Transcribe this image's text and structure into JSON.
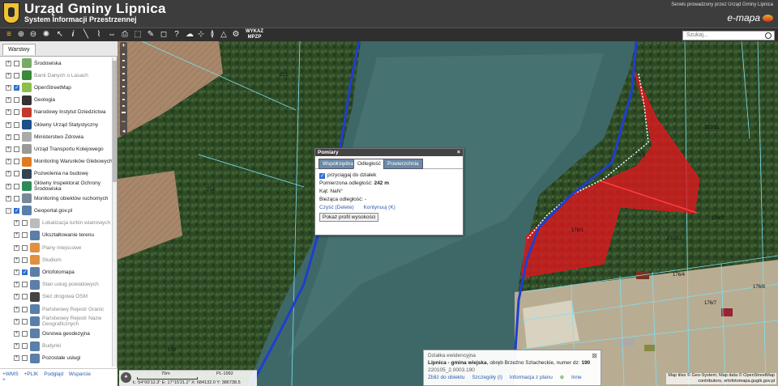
{
  "header": {
    "title": "Urząd Gminy Lipnica",
    "subtitle": "System Informacji Przestrzennej",
    "provider": "Serwis prowadzony przez Urząd Gminy Lipnica",
    "logo_text": "e-mapa"
  },
  "toolbar": {
    "wykaz_line1": "WYKAZ",
    "wykaz_line2": "MPZP",
    "search_placeholder": "Szukaj..."
  },
  "panel": {
    "tab_label": "Warstwy",
    "layers": [
      {
        "label": "Środowiska",
        "checked": false,
        "dim": false,
        "icon": "layer-icon",
        "color": "#7a6"
      },
      {
        "label": "Bank Danych o Lasach",
        "checked": false,
        "dim": true,
        "icon": "forest-icon",
        "color": "#3a8a3a"
      },
      {
        "label": "OpenStreetMap",
        "checked": true,
        "dim": false,
        "icon": "osm-icon",
        "color": "#8bbf4a"
      },
      {
        "label": "Geologia",
        "checked": false,
        "dim": false,
        "icon": "hammer-icon",
        "color": "#333"
      },
      {
        "label": "Narodowy Instytut Dziedzictwa",
        "checked": false,
        "dim": false,
        "icon": "heritage-icon",
        "color": "#c0392b"
      },
      {
        "label": "Główny Urząd Statystyczny",
        "checked": false,
        "dim": false,
        "icon": "stats-icon",
        "color": "#1a4f8a"
      },
      {
        "label": "Ministerstwo Zdrowia",
        "checked": false,
        "dim": false,
        "icon": "health-icon",
        "color": "#aaa"
      },
      {
        "label": "Urząd Transportu Kolejowego",
        "checked": false,
        "dim": false,
        "icon": "rail-icon",
        "color": "#999"
      },
      {
        "label": "Monitoring Warunków Glebowych",
        "checked": false,
        "dim": false,
        "icon": "soil-icon",
        "color": "#e07b20"
      },
      {
        "label": "Pozwolenia na budowę",
        "checked": false,
        "dim": false,
        "icon": "permit-icon",
        "color": "#345"
      },
      {
        "label": "Główny Inspektorat Ochrony Środowiska",
        "checked": false,
        "dim": false,
        "icon": "gios-icon",
        "color": "#2e8b57"
      },
      {
        "label": "Monitoring obiektów ruchomych",
        "checked": false,
        "dim": false,
        "icon": "tracking-icon",
        "color": "#789"
      },
      {
        "label": "Geoportal.gov.pl",
        "checked": true,
        "dim": false,
        "icon": "geoportal-icon",
        "color": "#5a7fa8",
        "expanded": true
      },
      {
        "label": "Lokalizacja turbin wiatrowych",
        "checked": false,
        "dim": true,
        "icon": "turbine-icon",
        "color": "#bbb",
        "child": true
      },
      {
        "label": "Ukształtowanie terenu",
        "checked": false,
        "dim": false,
        "icon": "terrain-icon",
        "color": "#5a7fa8",
        "child": true
      },
      {
        "label": "Plany miejscowe",
        "checked": false,
        "dim": true,
        "icon": "plans-icon",
        "color": "#e09040",
        "child": true
      },
      {
        "label": "Studium",
        "checked": false,
        "dim": true,
        "icon": "study-icon",
        "color": "#e09040",
        "child": true
      },
      {
        "label": "Ortofotomapa",
        "checked": true,
        "dim": false,
        "icon": "orthophoto-icon",
        "color": "#5a7fa8",
        "child": true
      },
      {
        "label": "Stan usług powiatowych",
        "checked": false,
        "dim": true,
        "icon": "services-icon",
        "color": "#5a7fa8",
        "child": true
      },
      {
        "label": "Sieć drogowa OSM",
        "checked": false,
        "dim": true,
        "icon": "road-icon",
        "color": "#444",
        "child": true
      },
      {
        "label": "Państwowy Rejestr Granic",
        "checked": false,
        "dim": true,
        "icon": "borders-icon",
        "color": "#5a7fa8",
        "child": true
      },
      {
        "label": "Państwowy Rejestr Nazw Geograficznych",
        "checked": false,
        "dim": true,
        "icon": "names-icon",
        "color": "#5a7fa8",
        "child": true
      },
      {
        "label": "Osnowa geodezyjna",
        "checked": false,
        "dim": false,
        "icon": "geodesy-icon",
        "color": "#5a7fa8",
        "child": true
      },
      {
        "label": "Budynki",
        "checked": false,
        "dim": true,
        "icon": "buildings-icon",
        "color": "#5a7fa8",
        "child": true
      },
      {
        "label": "Pozostałe usługi",
        "checked": false,
        "dim": false,
        "icon": "other-icon",
        "color": "#5a7fa8",
        "child": true
      }
    ],
    "footer_links": [
      "+WMS",
      "+PLIK",
      "Podgląd",
      "Wsparcie"
    ],
    "footer_second": "+"
  },
  "measure_dialog": {
    "title": "Pomiary",
    "tabs": [
      "Współrzędna",
      "Odległość",
      "Powierzchnia"
    ],
    "active_tab": 1,
    "snap_label": "przyciągaj do działek",
    "measured_label": "Pomierzona odległość:",
    "measured_value": "242 m",
    "angle_label": "Kąt: NaN°",
    "current_label": "Bieżąca odległość: -",
    "clear_link": "Czyść (Delete)",
    "continue_link": "Kontynuuj (K)",
    "profile_button": "Pokaż profil wysokości"
  },
  "parcel_info": {
    "heading": "Działka ewidencyjna",
    "place": "Lipnica - gmina wiejska",
    "precinct": ", obręb Brzeźno Szlacheckie",
    "number_label": ", numer dz:",
    "number": "190",
    "ident": "220105_2.0003.190",
    "links": [
      "Zbliż do obiektu",
      "Szczegóły (I)",
      "Informacja z planu",
      "Inne"
    ]
  },
  "coords": {
    "scale_label": "70m",
    "crs": "PL-1992",
    "text": "Ł: 54°00'12.3\"  E: 17°15'21.2\"  X: 684132.0  Y: 386738.5"
  },
  "attribution": {
    "line1": "Map tiles © Geo-System; Map data © OpenStreetMap",
    "line2": "contributors, ortofotomapa.gugik.gov.pl"
  },
  "map_labels": [
    {
      "text": "212"
    },
    {
      "text": "214"
    },
    {
      "text": "130"
    },
    {
      "text": "176/3"
    },
    {
      "text": "176/1"
    },
    {
      "text": "210/11"
    },
    {
      "text": "176/2"
    },
    {
      "text": "176/4"
    },
    {
      "text": "210/12"
    },
    {
      "text": "176/7"
    },
    {
      "text": "176/8"
    }
  ],
  "colors": {
    "header_bg": "#3d3d3d",
    "parcel_fill": "#e0161e",
    "boundary_line": "#1f3ed0"
  }
}
